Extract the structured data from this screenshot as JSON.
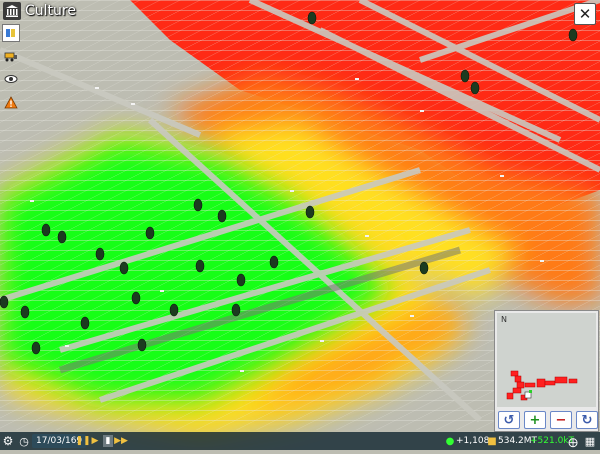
{
  "header": {
    "title": "Culture",
    "icon": "museum-icon"
  },
  "left_tools": [
    {
      "name": "layer-panel-icon"
    },
    {
      "name": "bulldozer-icon"
    },
    {
      "name": "eye-icon"
    },
    {
      "name": "warning-icon"
    }
  ],
  "close_icon": "close-icon",
  "minimap": {
    "compass": "N",
    "controls": [
      "rotate-left-icon",
      "zoom-in-icon",
      "zoom-out-icon",
      "rotate-right-icon"
    ]
  },
  "status": {
    "date": "17/03/169",
    "population_change": "+1,108",
    "money": "534.2M",
    "money_unit": "T",
    "income": "+521.0kT"
  },
  "colors": {
    "ground": "#bdbdb2",
    "road": "#a9aaa3",
    "high": "#ff2a15",
    "mid": "#ff8a10",
    "low": "#ffe020",
    "green": "#19ff19",
    "accent_button": "#6a88c8"
  }
}
